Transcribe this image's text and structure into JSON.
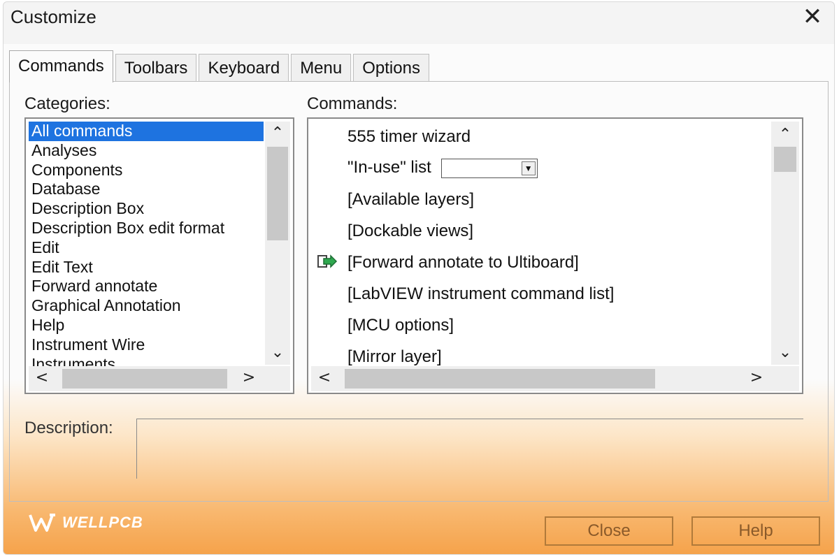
{
  "window": {
    "title": "Customize"
  },
  "tabs": [
    {
      "label": "Commands",
      "active": true
    },
    {
      "label": "Toolbars",
      "active": false
    },
    {
      "label": "Keyboard",
      "active": false
    },
    {
      "label": "Menu",
      "active": false
    },
    {
      "label": "Options",
      "active": false
    }
  ],
  "categories": {
    "label": "Categories:",
    "items": [
      "All commands",
      "Analyses",
      "Components",
      "Database",
      "Description Box",
      "Description Box edit format",
      "Edit",
      "Edit Text",
      "Forward annotate",
      "Graphical Annotation",
      "Help",
      "Instrument Wire",
      "Instruments"
    ],
    "selected": "All commands"
  },
  "commands": {
    "label": "Commands:",
    "items": [
      "555 timer wizard",
      "\"In-use\" list",
      "[Available layers]",
      "[Dockable views]",
      "[Forward annotate to Ultiboard]",
      "[LabVIEW instrument command list]",
      "[MCU options]",
      "[Mirror layer]"
    ]
  },
  "description": {
    "label": "Description:"
  },
  "buttons": {
    "close": "Close",
    "help": "Help"
  },
  "branding": {
    "logo_text": "WELLPCB"
  },
  "icons": {
    "close": "close-icon",
    "forward": "forward-annotate-icon",
    "scroll_up": "chevron-up-icon",
    "scroll_down": "chevron-down-icon",
    "scroll_left": "chevron-left-icon",
    "scroll_right": "chevron-right-icon"
  },
  "colors": {
    "selection": "#1e73e0",
    "footer_gradient": "#f5a24a"
  }
}
